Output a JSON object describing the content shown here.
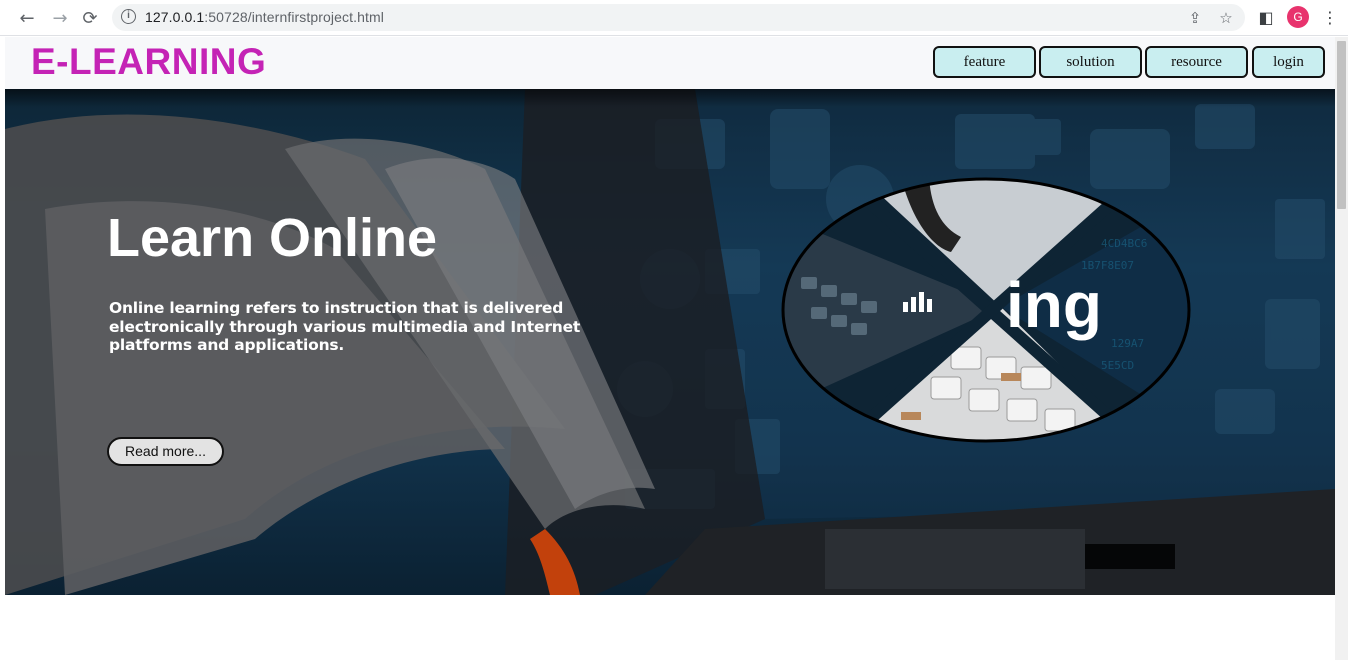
{
  "browser": {
    "url_host": "127.0.0.1",
    "url_rest": ":50728/internfirstproject.html",
    "profile_initial": "G"
  },
  "site": {
    "logo": "E-LEARNING",
    "menu": [
      "feature",
      "solution",
      "resource",
      "login"
    ]
  },
  "hero": {
    "title": "Learn Online",
    "description": "Online learning refers to instruction that is delivered electronically through various multimedia and Internet platforms and applications.",
    "button": "Read more...",
    "image_text": "ing"
  },
  "colors": {
    "logo": "#c423b5",
    "menu_button": "#c9eef0",
    "hero_background": "#143a55"
  }
}
